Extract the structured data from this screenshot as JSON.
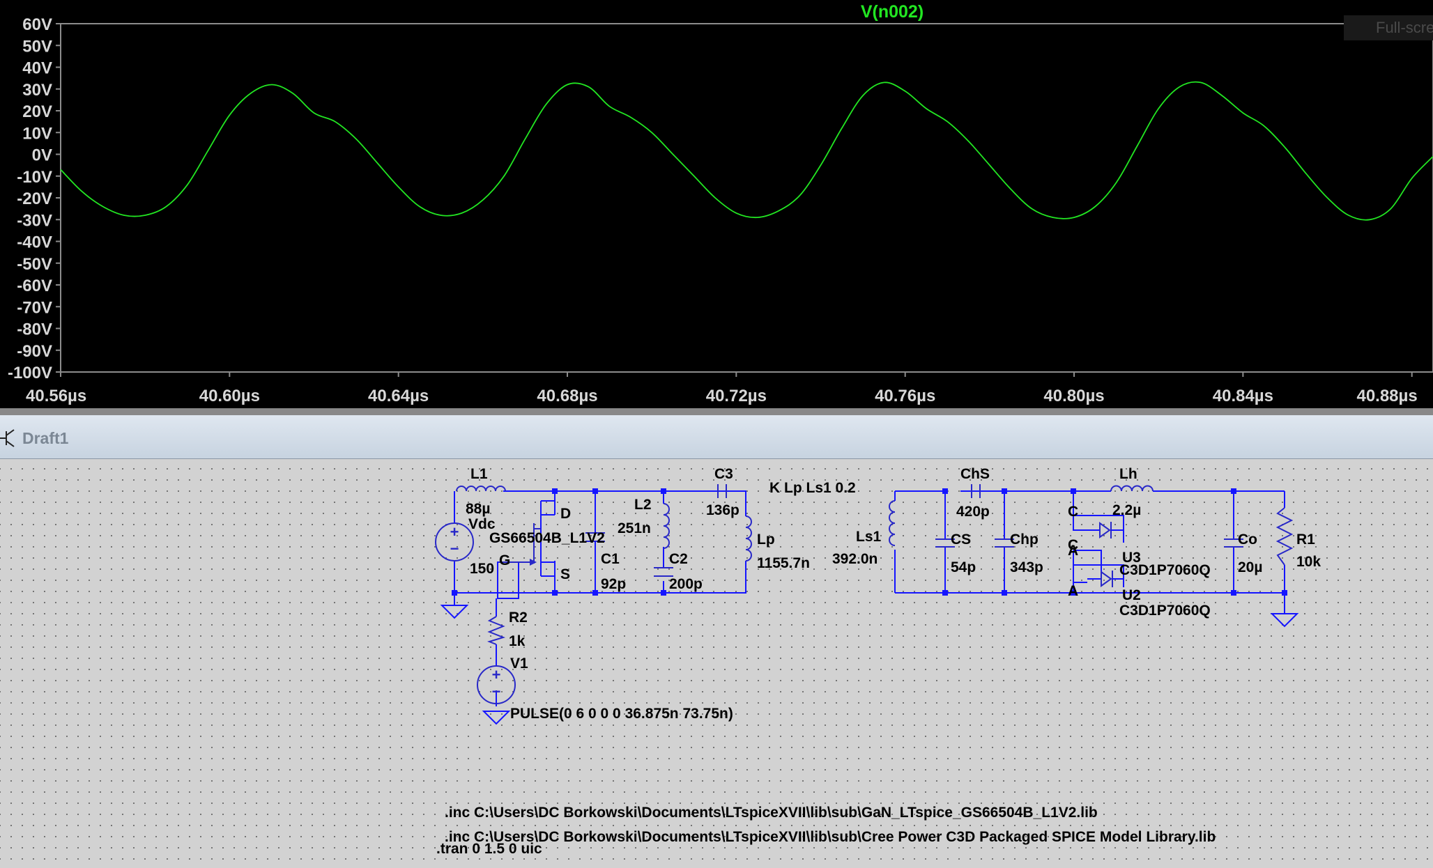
{
  "waveform": {
    "trace_title": "V(n002)",
    "trace_color": "#22e622",
    "fullscreen_label": "Full-screen"
  },
  "chart_data": {
    "type": "line",
    "title": "V(n002)",
    "xlabel": "",
    "ylabel": "",
    "xlim": [
      40.56,
      40.885
    ],
    "ylim": [
      -100,
      60
    ],
    "x_unit": "µs",
    "y_unit": "V",
    "x_ticks": [
      "40.56µs",
      "40.60µs",
      "40.64µs",
      "40.68µs",
      "40.72µs",
      "40.76µs",
      "40.80µs",
      "40.84µs",
      "40.88µs"
    ],
    "y_ticks": [
      "60V",
      "50V",
      "40V",
      "30V",
      "20V",
      "10V",
      "0V",
      "-10V",
      "-20V",
      "-30V",
      "-40V",
      "-50V",
      "-60V",
      "-70V",
      "-80V",
      "-90V",
      "-100V"
    ],
    "grid": false,
    "series": [
      {
        "name": "V(n002)",
        "x": [
          40.56,
          40.565,
          40.57,
          40.575,
          40.58,
          40.585,
          40.59,
          40.595,
          40.6,
          40.605,
          40.61,
          40.615,
          40.62,
          40.625,
          40.63,
          40.635,
          40.64,
          40.645,
          40.65,
          40.655,
          40.66,
          40.665,
          40.67,
          40.675,
          40.68,
          40.685,
          40.69,
          40.695,
          40.7,
          40.705,
          40.71,
          40.715,
          40.72,
          40.725,
          40.73,
          40.735,
          40.74,
          40.745,
          40.75,
          40.755,
          40.76,
          40.765,
          40.77,
          40.775,
          40.78,
          40.785,
          40.79,
          40.795,
          40.8,
          40.805,
          40.81,
          40.815,
          40.82,
          40.825,
          40.83,
          40.835,
          40.84,
          40.845,
          40.85,
          40.855,
          40.86,
          40.865,
          40.87,
          40.875,
          40.88,
          40.885
        ],
        "y": [
          -7,
          -17,
          -24,
          -28,
          -28,
          -24,
          -14,
          2,
          18,
          28,
          32,
          28,
          19,
          15,
          7,
          -4,
          -15,
          -24,
          -28,
          -27,
          -21,
          -10,
          7,
          23,
          32,
          31,
          22,
          17,
          10,
          0,
          -10,
          -20,
          -27,
          -29,
          -26,
          -19,
          -5,
          12,
          27,
          33,
          29,
          21,
          15,
          6,
          -5,
          -16,
          -25,
          -29,
          -29,
          -24,
          -13,
          4,
          21,
          31,
          33,
          27,
          19,
          13,
          3,
          -9,
          -20,
          -28,
          -30,
          -25,
          -11,
          -1
        ]
      }
    ]
  },
  "schematic": {
    "tab_title": "Draft1",
    "components": {
      "L1": {
        "name": "L1",
        "value": "88µ"
      },
      "Vdc": {
        "name": "Vdc",
        "value": "150"
      },
      "M1": {
        "model": "GS66504B_L1V2",
        "pin_d": "D",
        "pin_g": "G",
        "pin_s": "S"
      },
      "C1": {
        "name": "C1",
        "value": "92p"
      },
      "L2": {
        "name": "L2",
        "value": "251n"
      },
      "C2": {
        "name": "C2",
        "value": "200p"
      },
      "C3": {
        "name": "C3",
        "value": "136p"
      },
      "Lp": {
        "name": "Lp",
        "value": "1155.7n"
      },
      "R2": {
        "name": "R2",
        "value": "1k"
      },
      "V1": {
        "name": "V1",
        "value": "PULSE(0 6 0 0 0 36.875n 73.75n)"
      },
      "Ls1": {
        "name": "Ls1",
        "value": "392.0n"
      },
      "ChS": {
        "name": "ChS",
        "value": "420p"
      },
      "CS": {
        "name": "CS",
        "value": "54p"
      },
      "Chp": {
        "name": "Chp",
        "value": "343p"
      },
      "Lh": {
        "name": "Lh",
        "value": "2.2µ"
      },
      "U3": {
        "name": "U3",
        "value": "C3D1P7060Q",
        "pin_c": "C",
        "pin_a": "A"
      },
      "U2": {
        "name": "U2",
        "value": "C3D1P7060Q",
        "pin_c": "C",
        "pin_a": "A"
      },
      "Co": {
        "name": "Co",
        "value": "20µ"
      },
      "R1": {
        "name": "R1",
        "value": "10k"
      }
    },
    "directives": {
      "coupling": "K Lp Ls1 0.2",
      "inc1": ".inc C:\\Users\\DC Borkowski\\Documents\\LTspiceXVII\\lib\\sub\\GaN_LTspice_GS66504B_L1V2.lib",
      "inc2": ".inc C:\\Users\\DC Borkowski\\Documents\\LTspiceXVII\\lib\\sub\\Cree Power C3D Packaged SPICE Model Library.lib",
      "tran": ".tran 0 1.5 0 uic"
    }
  }
}
